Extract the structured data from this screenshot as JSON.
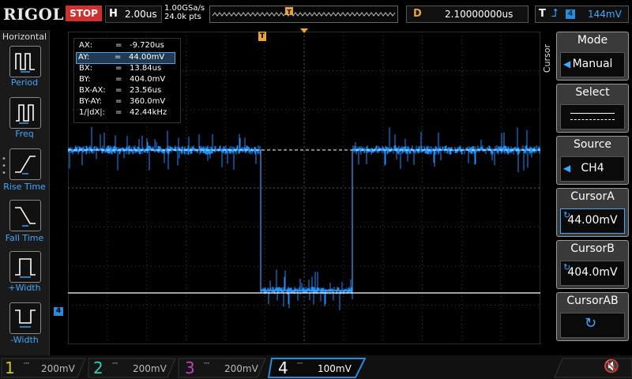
{
  "brand": "RIGOL",
  "status": "STOP",
  "horizontal": {
    "key": "H",
    "timebase": "2.00us"
  },
  "sample": {
    "rate": "1.00GSa/s",
    "points": "24.0k pts"
  },
  "delay": {
    "key": "D",
    "value": "2.10000000us"
  },
  "trigger": {
    "key": "T",
    "edge_icon": "rising-edge-icon",
    "source": "4",
    "level": "144mV"
  },
  "left_panel": {
    "title": "Horizontal",
    "buttons": [
      {
        "label": "Period",
        "icon": "period-icon"
      },
      {
        "label": "Freq",
        "icon": "freq-icon"
      },
      {
        "label": "Rise Time",
        "icon": "rise-time-icon"
      },
      {
        "label": "Fall Time",
        "icon": "fall-time-icon"
      },
      {
        "label": "+Width",
        "icon": "pos-width-icon"
      },
      {
        "label": "-Width",
        "icon": "neg-width-icon"
      }
    ]
  },
  "cursor_readout": [
    {
      "key": "AX:",
      "eq": "=",
      "value": "-9.720us"
    },
    {
      "key": "AY:",
      "eq": "=",
      "value": "44.00mV",
      "selected": true
    },
    {
      "key": "BX:",
      "eq": "=",
      "value": "13.84us"
    },
    {
      "key": "BY:",
      "eq": "=",
      "value": "404.0mV"
    },
    {
      "key": "BX-AX:",
      "eq": "=",
      "value": "23.56us"
    },
    {
      "key": "BY-AY:",
      "eq": "=",
      "value": "360.0mV"
    },
    {
      "key": "1/|dX|:",
      "eq": "=",
      "value": "42.44kHz"
    }
  ],
  "right_panel": {
    "vertical_label": "Cursor",
    "mode": {
      "title": "Mode",
      "value": "Manual"
    },
    "select": {
      "title": "Select"
    },
    "source": {
      "title": "Source",
      "value": "CH4"
    },
    "cursor_a": {
      "title": "CursorA",
      "value": "44.00mV"
    },
    "cursor_b": {
      "title": "CursorB",
      "value": "404.0mV"
    },
    "cursor_ab": {
      "title": "CursorAB"
    }
  },
  "channels": [
    {
      "num": "1",
      "scale": "200mV",
      "color": "#c8c830",
      "active": false
    },
    {
      "num": "2",
      "scale": "200mV",
      "color": "#2fd0c0",
      "active": false
    },
    {
      "num": "3",
      "scale": "200mV",
      "color": "#c040c0",
      "active": false
    },
    {
      "num": "4",
      "scale": "100mV",
      "color": "#2c8bd8",
      "active": true
    }
  ],
  "markers": {
    "trigger_pos": "T",
    "ch4_ground": "4",
    "trigger_level": "T"
  },
  "colors": {
    "ch4": "#1e90ff",
    "accent": "#e8a63a",
    "stop": "#d0302f"
  }
}
